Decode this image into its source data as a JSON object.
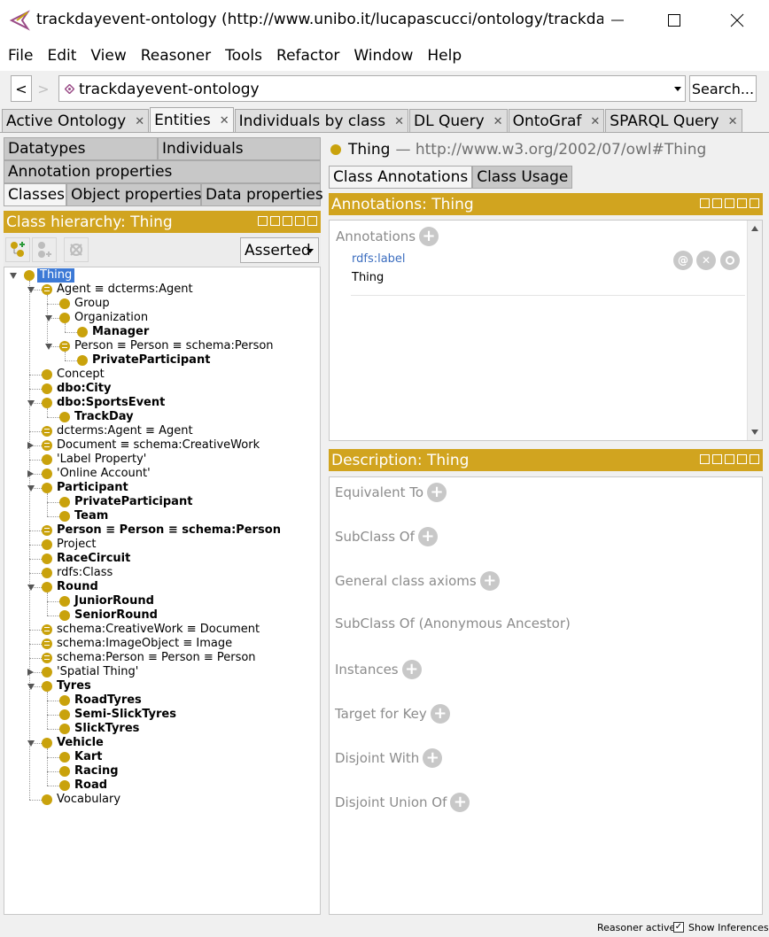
{
  "window": {
    "title": "trackdayevent-ontology (http://www.unibo.it/lucapascucci/ontology/trackda..."
  },
  "menu": [
    "File",
    "Edit",
    "View",
    "Reasoner",
    "Tools",
    "Refactor",
    "Window",
    "Help"
  ],
  "address": {
    "back": "<",
    "forward": ">",
    "ontology": "trackdayevent-ontology",
    "search_label": "Search..."
  },
  "main_tabs": [
    {
      "label": "Active Ontology"
    },
    {
      "label": "Entities"
    },
    {
      "label": "Individuals by class"
    },
    {
      "label": "DL Query"
    },
    {
      "label": "OntoGraf"
    },
    {
      "label": "SPARQL Query"
    }
  ],
  "left_tabs": {
    "datatypes": "Datatypes",
    "individuals": "Individuals",
    "annotation_properties": "Annotation properties",
    "classes": "Classes",
    "object_properties": "Object properties",
    "data_properties": "Data properties"
  },
  "class_hierarchy": {
    "header": "Class hierarchy: Thing",
    "mode": "Asserted",
    "nodes": [
      {
        "label": "Thing"
      },
      {
        "label": "Agent ≡ dcterms:Agent"
      },
      {
        "label": "Group"
      },
      {
        "label": "Organization"
      },
      {
        "label": "Manager"
      },
      {
        "label": "Person ≡ Person ≡ schema:Person"
      },
      {
        "label": "PrivateParticipant"
      },
      {
        "label": "Concept"
      },
      {
        "label": "dbo:City"
      },
      {
        "label": "dbo:SportsEvent"
      },
      {
        "label": "TrackDay"
      },
      {
        "label": "dcterms:Agent ≡ Agent"
      },
      {
        "label": "Document ≡ schema:CreativeWork"
      },
      {
        "label": "'Label Property'"
      },
      {
        "label": "'Online Account'"
      },
      {
        "label": "Participant"
      },
      {
        "label": "PrivateParticipant"
      },
      {
        "label": "Team"
      },
      {
        "label": "Person ≡ Person ≡ schema:Person"
      },
      {
        "label": "Project"
      },
      {
        "label": "RaceCircuit"
      },
      {
        "label": "rdfs:Class"
      },
      {
        "label": "Round"
      },
      {
        "label": "JuniorRound"
      },
      {
        "label": "SeniorRound"
      },
      {
        "label": "schema:CreativeWork ≡ Document"
      },
      {
        "label": "schema:ImageObject ≡ Image"
      },
      {
        "label": "schema:Person ≡ Person ≡ Person"
      },
      {
        "label": "'Spatial Thing'"
      },
      {
        "label": "Tyres"
      },
      {
        "label": "RoadTyres"
      },
      {
        "label": "Semi-SlickTyres"
      },
      {
        "label": "SlickTyres"
      },
      {
        "label": "Vehicle"
      },
      {
        "label": "Kart"
      },
      {
        "label": "Racing"
      },
      {
        "label": "Road"
      },
      {
        "label": "Vocabulary"
      }
    ]
  },
  "entity": {
    "name": "Thing",
    "uri": "— http://www.w3.org/2002/07/owl#Thing"
  },
  "right_tabs": {
    "annotations": "Class Annotations",
    "usage": "Class Usage"
  },
  "annotations": {
    "header": "Annotations: Thing",
    "section": "Annotations",
    "property": "rdfs:label",
    "value": "Thing"
  },
  "description": {
    "header": "Description: Thing",
    "sections": [
      "Equivalent To",
      "SubClass Of",
      "General class axioms",
      "SubClass Of (Anonymous Ancestor)",
      "Instances",
      "Target for Key",
      "Disjoint With",
      "Disjoint Union Of"
    ]
  },
  "status": {
    "reasoner": "Reasoner active",
    "show_inferences": "Show Inferences"
  },
  "colors": {
    "view_header": "#d1a41f",
    "class_bullet": "#c9a20c",
    "selection": "#3c79d6"
  }
}
